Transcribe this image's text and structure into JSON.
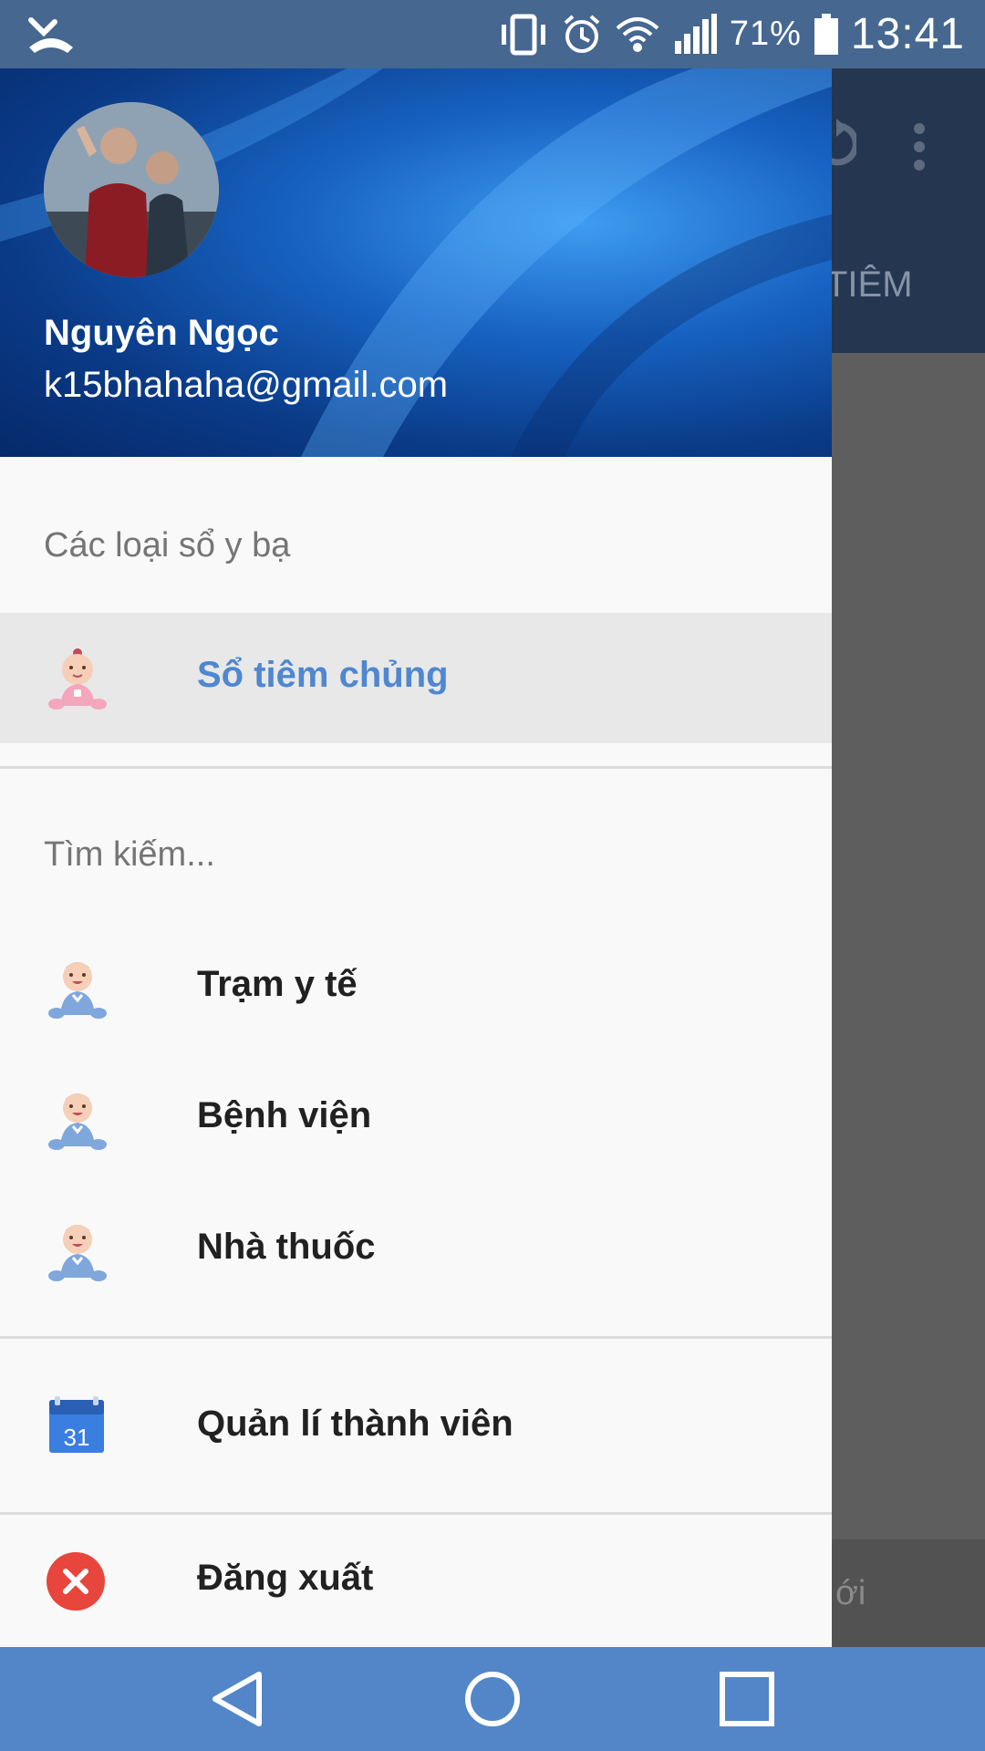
{
  "status_bar": {
    "battery_percent": "71%",
    "time": "13:41"
  },
  "background_app": {
    "tab_label": "TIÊM",
    "bottom_text": "ới"
  },
  "drawer": {
    "user_name": "Nguyên Ngọc",
    "user_email": "k15bhahaha@gmail.com",
    "sections": [
      {
        "header": "Các loại sổ y bạ",
        "items": [
          {
            "label": "Sổ tiêm chủng",
            "icon": "baby-girl-icon",
            "active": true
          }
        ]
      },
      {
        "header": "Tìm kiếm...",
        "items": [
          {
            "label": "Trạm y tế",
            "icon": "baby-boy-icon",
            "active": false
          },
          {
            "label": "Bệnh viện",
            "icon": "baby-boy-icon",
            "active": false
          },
          {
            "label": "Nhà thuốc",
            "icon": "baby-boy-icon",
            "active": false
          }
        ]
      },
      {
        "header": "",
        "items": [
          {
            "label": "Quản lí thành viên",
            "icon": "calendar-icon",
            "calendar_day": "31",
            "active": false
          }
        ]
      },
      {
        "header": "",
        "items": [
          {
            "label": "Đăng xuất",
            "icon": "logout-close-icon",
            "active": false
          }
        ]
      }
    ]
  },
  "colors": {
    "status_bar": "#46678f",
    "nav_bar": "#5286c8",
    "active_item_text": "#4f87d0",
    "active_item_bg": "#e8e8e8"
  }
}
